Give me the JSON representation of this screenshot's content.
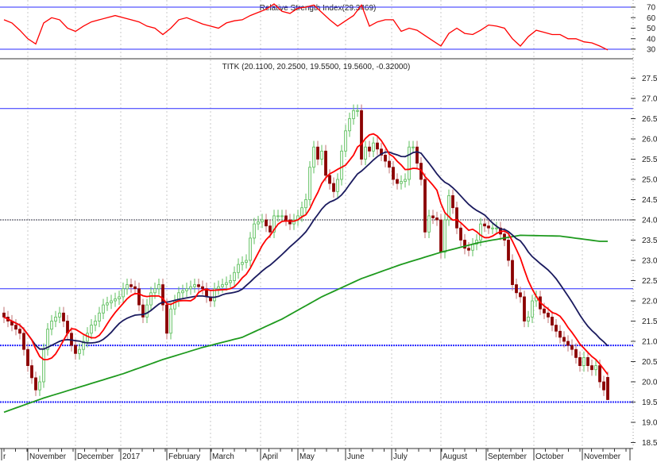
{
  "chart_data": {
    "type": "candlestick",
    "title": "TITK (20.1100, 20.2500, 19.5500, 19.5600, -0.32000)",
    "last_ohlc": {
      "open": 20.11,
      "high": 20.25,
      "low": 19.55,
      "close": 19.56,
      "change": -0.32
    },
    "ylim": [
      18.5,
      27.5
    ],
    "yticks": [
      "27.5",
      "27.0",
      "26.5",
      "26.0",
      "25.5",
      "25.0",
      "24.5",
      "24.0",
      "23.5",
      "23.0",
      "22.5",
      "22.0",
      "21.5",
      "21.0",
      "20.5",
      "20.0",
      "19.5",
      "19.0",
      "18.5"
    ],
    "xlabels": [
      "r",
      "November",
      "December",
      "2017",
      "February",
      "March",
      "April",
      "May",
      "June",
      "July",
      "August",
      "September",
      "October",
      "November",
      "|"
    ],
    "closes": [
      21.6,
      21.5,
      21.4,
      21.3,
      21.2,
      20.8,
      20.4,
      20.1,
      19.8,
      20.0,
      20.8,
      21.3,
      21.5,
      21.6,
      21.7,
      21.5,
      21.2,
      20.9,
      20.7,
      20.8,
      21.0,
      21.2,
      21.4,
      21.5,
      21.7,
      21.9,
      21.95,
      22.0,
      22.05,
      22.1,
      22.3,
      22.4,
      22.35,
      22.3,
      21.9,
      21.6,
      21.9,
      22.2,
      22.3,
      22.4,
      21.9,
      21.2,
      21.8,
      22.0,
      22.2,
      22.25,
      22.3,
      22.35,
      22.4,
      22.35,
      22.3,
      22.1,
      22.0,
      22.3,
      22.35,
      22.4,
      22.45,
      22.5,
      22.7,
      22.9,
      22.95,
      23.0,
      23.55,
      23.9,
      23.95,
      24.0,
      23.85,
      23.7,
      24.1,
      24.1,
      24.1,
      24.0,
      23.9,
      24.0,
      24.1,
      24.3,
      24.5,
      25.3,
      25.8,
      25.5,
      25.7,
      25.1,
      24.9,
      24.7,
      25.0,
      25.7,
      26.2,
      26.5,
      26.7,
      26.7,
      25.5,
      25.8,
      25.7,
      25.9,
      25.75,
      25.6,
      25.45,
      25.3,
      25.0,
      24.9,
      24.95,
      25.0,
      25.8,
      25.8,
      25.4,
      25.0,
      23.7,
      24.1,
      24.05,
      24.0,
      23.2,
      24.0,
      24.6,
      24.3,
      23.8,
      23.5,
      23.3,
      23.25,
      23.4,
      23.5,
      23.9,
      23.85,
      23.8,
      23.8,
      23.8,
      23.65,
      23.5,
      23.0,
      22.4,
      22.2,
      22.1,
      21.5,
      21.6,
      22.0,
      22.1,
      21.8,
      21.7,
      21.6,
      21.4,
      21.25,
      21.1,
      21.0,
      20.9,
      20.8,
      20.6,
      20.4,
      20.6,
      20.4,
      20.3,
      20.4,
      20.0,
      19.8,
      19.56
    ],
    "ma_short_period": 8,
    "ma_mid_period": 20,
    "ma_long_samples": [
      19.25,
      19.6,
      19.9,
      20.2,
      20.55,
      20.85,
      21.1,
      21.55,
      22.1,
      22.55,
      22.9,
      23.2,
      23.45,
      23.62,
      23.6,
      23.47
    ],
    "hlines": [
      26.75,
      24.0,
      22.3,
      20.9,
      19.5
    ],
    "colors": {
      "up": "#5cbf5c",
      "up_fill": "#eaf7ea",
      "down": "#8b0000",
      "ma_short": "#ff0000",
      "ma_mid": "#1a1a5e",
      "ma_long": "#1e9a1e",
      "hline": "#2a2aff"
    },
    "rsi": {
      "title": "Relative Strength Index(29.3469)",
      "ylim": [
        20,
        80
      ],
      "yticks": [
        "70",
        "60",
        "50",
        "40",
        "30"
      ],
      "levels": [
        70,
        30
      ],
      "values": [
        58,
        55,
        48,
        40,
        35,
        55,
        60,
        58,
        50,
        47,
        52,
        56,
        58,
        60,
        62,
        60,
        58,
        56,
        52,
        50,
        44,
        50,
        58,
        60,
        57,
        54,
        52,
        50,
        55,
        57,
        58,
        62,
        65,
        68,
        73,
        66,
        64,
        69,
        70,
        72,
        65,
        58,
        52,
        57,
        62,
        72,
        52,
        56,
        58,
        58,
        47,
        50,
        48,
        43,
        38,
        33,
        45,
        50,
        45,
        44,
        48,
        53,
        52,
        50,
        40,
        33,
        42,
        48,
        46,
        44,
        44,
        40,
        40,
        37,
        36,
        33,
        29.35
      ]
    }
  }
}
